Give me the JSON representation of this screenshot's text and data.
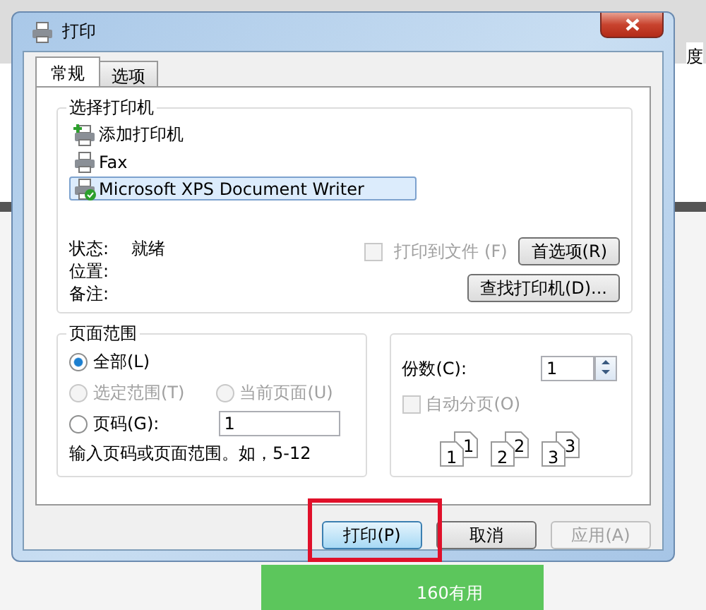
{
  "window": {
    "title": "打印"
  },
  "background": {
    "texts": [
      "度",
      "160有用"
    ]
  },
  "tabs": [
    {
      "label": "常规",
      "selected": true
    },
    {
      "label": "选项",
      "selected": false
    }
  ],
  "printer_group": {
    "title": "选择打印机",
    "printers": [
      {
        "name": "添加打印机",
        "kind": "add",
        "selected": false
      },
      {
        "name": "Fax",
        "kind": "printer",
        "selected": false
      },
      {
        "name": "Microsoft XPS Document Writer",
        "kind": "default",
        "selected": true
      }
    ]
  },
  "status": [
    {
      "label": "状态:",
      "value": "就绪"
    },
    {
      "label": "位置:"
    },
    {
      "label": "备注:"
    }
  ],
  "print_to_file": {
    "label": "打印到文件 (F)",
    "checked": false,
    "disabled": true
  },
  "preferences_button": "首选项(R)",
  "find_printer_button": "查找打印机(D)...",
  "page_range": {
    "title": "页面范围",
    "options": [
      {
        "label": "全部(L)",
        "selected": true,
        "disabled": false
      },
      {
        "label": "选定范围(T)",
        "selected": false,
        "disabled": true
      },
      {
        "label": "当前页面(U)",
        "selected": false,
        "disabled": true
      },
      {
        "label": "页码(G):",
        "selected": false,
        "disabled": false
      }
    ],
    "pages_value": "1",
    "hint": "输入页码或页面范围。如，5-12"
  },
  "copies": {
    "label": "份数(C):",
    "value": "1",
    "collate": {
      "label": "自动分页(O)",
      "checked": false,
      "disabled": true
    },
    "collate_icons": [
      [
        "1",
        "1"
      ],
      [
        "2",
        "2"
      ],
      [
        "3",
        "3"
      ]
    ]
  },
  "buttons": [
    {
      "label": "打印(P)",
      "disabled": false,
      "highlighted": true
    },
    {
      "label": "取消",
      "disabled": false,
      "highlighted": false
    },
    {
      "label": "应用(A)",
      "disabled": true,
      "highlighted": false
    }
  ]
}
